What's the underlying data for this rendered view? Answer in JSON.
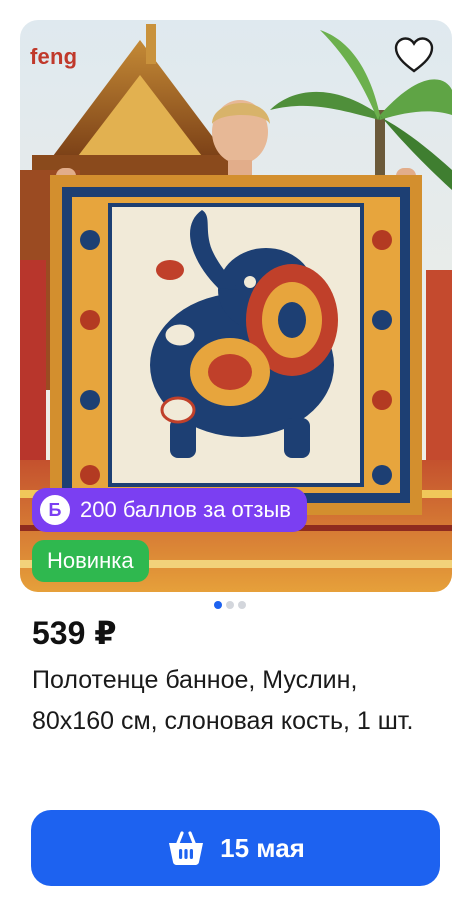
{
  "product": {
    "brand": "feng",
    "points_badge": {
      "icon_letter": "Б",
      "text": "200 баллов за отзыв"
    },
    "new_badge": "Новинка",
    "carousel": {
      "total": 3,
      "active": 1
    },
    "price": "539 ₽",
    "title": "Полотенце банное, Муслин, 80х160 см, слоновая кость, 1 шт."
  },
  "cart_button": {
    "label": "15 мая",
    "icon": "basket-icon"
  },
  "icons": {
    "favorite": "heart-icon"
  },
  "colors": {
    "accent_blue": "#1d62f0",
    "points_purple": "#7b3ff2",
    "new_green": "#2fb84f",
    "brand_red": "#c0392b"
  }
}
